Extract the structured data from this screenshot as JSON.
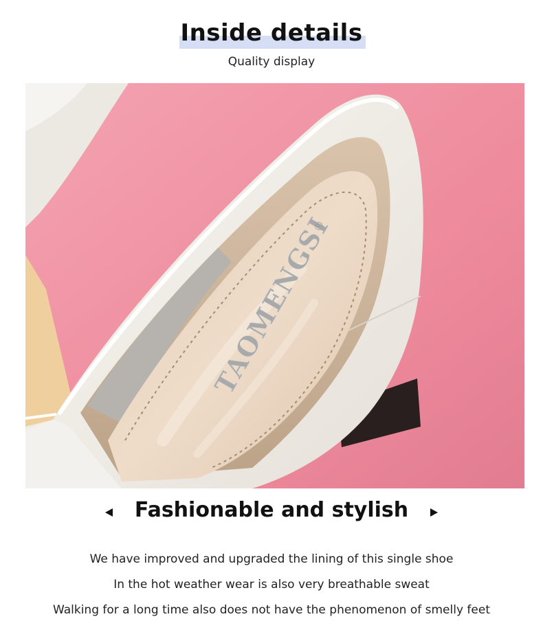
{
  "header": {
    "title": "Inside details",
    "subtitle": "Quality display",
    "highlight_color": "#d6def5"
  },
  "photo": {
    "brand_text": "TAOMENGSI",
    "registered_mark": "®",
    "background_color": "#ee8d9e",
    "shoe_color": "#f2efe9",
    "insole_color": "#e8d5c1"
  },
  "feature": {
    "heading": "Fashionable and stylish",
    "prev_icon": "triangle-left-icon",
    "next_icon": "triangle-right-icon",
    "lines": [
      "We have improved and upgraded the lining of this single shoe",
      "In the hot weather wear is also very breathable sweat",
      "Walking for a long time also does not have the phenomenon of smelly feet"
    ]
  }
}
